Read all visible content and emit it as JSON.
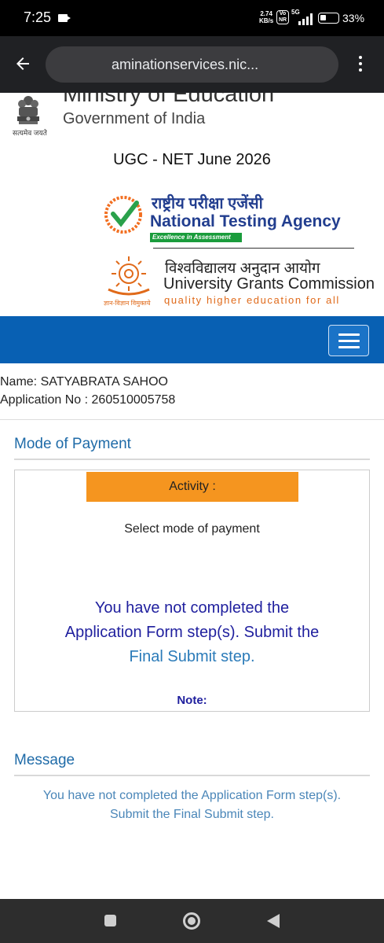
{
  "status_bar": {
    "time": "7:25",
    "net_speed_value": "2.74",
    "net_speed_unit": "KB/s",
    "volte_top": "Vo",
    "volte_bottom": "NR",
    "network": "5G",
    "battery": "33%"
  },
  "browser": {
    "url": "aminationservices.nic..."
  },
  "header": {
    "ministry": "Ministry of Education",
    "government": "Government of India",
    "emblem_motto": "सत्यमेव जयते",
    "exam_title": "UGC - NET June 2026"
  },
  "nta": {
    "hindi_name": "राष्ट्रीय परीक्षा एजेंसी",
    "name": "National Testing Agency",
    "tagline": "Excellence in Assessment"
  },
  "ugc": {
    "hindi_name": "विश्वविद्यालय अनुदान आयोग",
    "name": "University Grants Commission",
    "tagline": "quality higher education for all",
    "logo_motto": "ज्ञान-विज्ञान विमुक्तये"
  },
  "candidate": {
    "name_label": "Name:",
    "name_value": "SATYABRATA SAHOO",
    "app_label": "Application No :",
    "app_value": "260510005758"
  },
  "payment": {
    "section_title": "Mode of Payment",
    "activity_label": "Activity :",
    "select_text": "Select mode of payment",
    "warning_part1": "You have not completed the Application Form step(s). Submit the",
    "warning_link": "Final Submit",
    "warning_part2": "step.",
    "note_label": "Note:"
  },
  "message": {
    "section_title": "Message",
    "text": "You have not completed the Application Form step(s). Submit the Final Submit step."
  },
  "colors": {
    "nav_blue": "#0860b3",
    "activity_orange": "#f5951f",
    "section_blue": "#1f6ba8",
    "warning_navy": "#1f1f9e"
  }
}
